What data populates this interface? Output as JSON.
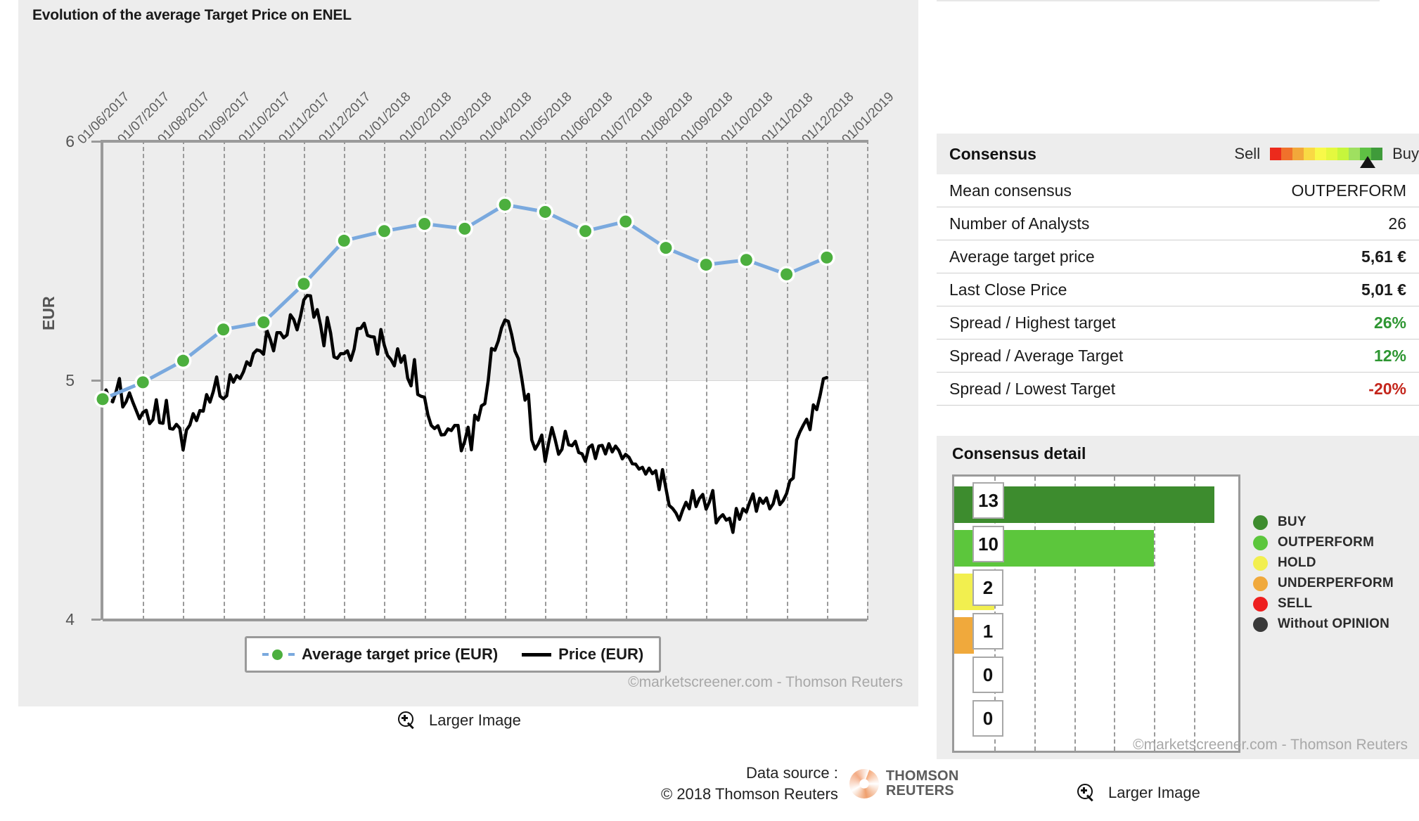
{
  "chart_panel": {
    "title": "Evolution of the average Target Price on ENEL",
    "ylabel": "EUR",
    "credit": "©marketscreener.com - Thomson Reuters",
    "legend": {
      "target_label": "Average target price (EUR)",
      "price_label": "Price (EUR)"
    },
    "larger_image_label": "Larger Image"
  },
  "datasource": {
    "line1": "Data source :",
    "line2": "© 2018 Thomson Reuters",
    "logo_line1": "THOMSON",
    "logo_line2": "REUTERS"
  },
  "consensus": {
    "title": "Consensus",
    "gauge_left": "Sell",
    "gauge_right": "Buy",
    "gauge_marker_percent": 87,
    "rows": [
      {
        "key": "Mean consensus",
        "value": "OUTPERFORM",
        "style": "plain"
      },
      {
        "key": "Number of Analysts",
        "value": "26",
        "style": "plain"
      },
      {
        "key": "Average target price",
        "value": "5,61 €",
        "style": "bold"
      },
      {
        "key": "Last Close Price",
        "value": "5,01 €",
        "style": "bold"
      },
      {
        "key": "Spread / Highest target",
        "value": "26%",
        "style": "pos"
      },
      {
        "key": "Spread / Average Target",
        "value": "12%",
        "style": "pos"
      },
      {
        "key": "Spread / Lowest Target",
        "value": "-20%",
        "style": "neg"
      }
    ]
  },
  "consensus_detail": {
    "title": "Consensus detail",
    "credit": "©marketscreener.com - Thomson Reuters",
    "larger_image_label": "Larger Image",
    "legend": [
      {
        "label": "BUY",
        "color": "#3d8c2e"
      },
      {
        "label": "OUTPERFORM",
        "color": "#5cc63c"
      },
      {
        "label": "HOLD",
        "color": "#f2ef4f"
      },
      {
        "label": "UNDERPERFORM",
        "color": "#f0a93c"
      },
      {
        "label": "SELL",
        "color": "#ee1f1f"
      },
      {
        "label": "Without OPINION",
        "color": "#3a3a3a"
      }
    ]
  },
  "chart_data": [
    {
      "type": "line",
      "title": "Evolution of the average Target Price on ENEL",
      "xlabel": "",
      "ylabel": "EUR",
      "ylim": [
        4,
        6
      ],
      "yticks": [
        4,
        5,
        6
      ],
      "grid": true,
      "legend_position": "bottom",
      "xticks": [
        "01/06/2017",
        "01/07/2017",
        "01/08/2017",
        "01/09/2017",
        "01/10/2017",
        "01/11/2017",
        "01/12/2017",
        "01/01/2018",
        "01/02/2018",
        "01/03/2018",
        "01/04/2018",
        "01/05/2018",
        "01/06/2018",
        "01/07/2018",
        "01/08/2018",
        "01/09/2018",
        "01/10/2018",
        "01/11/2018",
        "01/12/2018",
        "01/01/2019"
      ],
      "series": [
        {
          "name": "Average target price (EUR)",
          "color": "#7aa9de",
          "marker_color": "#4caf3e",
          "x": [
            "01/06/2017",
            "01/07/2017",
            "01/08/2017",
            "01/09/2017",
            "01/10/2017",
            "01/11/2017",
            "01/12/2017",
            "01/01/2018",
            "01/02/2018",
            "01/03/2018",
            "01/04/2018",
            "01/05/2018",
            "01/06/2018",
            "01/07/2018",
            "01/08/2018",
            "01/09/2018",
            "01/10/2018",
            "01/11/2018",
            "01/12/2018"
          ],
          "values": [
            4.92,
            4.99,
            5.08,
            5.21,
            5.24,
            5.4,
            5.58,
            5.62,
            5.65,
            5.63,
            5.73,
            5.7,
            5.62,
            5.66,
            5.55,
            5.48,
            5.5,
            5.44,
            5.51
          ]
        },
        {
          "name": "Price (EUR)",
          "color": "#000000",
          "x": [
            "01/06/2017",
            "01/07/2017",
            "01/08/2017",
            "01/09/2017",
            "01/10/2017",
            "01/11/2017",
            "01/12/2017",
            "01/01/2018",
            "01/02/2018",
            "01/03/2018",
            "01/04/2018",
            "01/05/2018",
            "01/06/2018",
            "01/07/2018",
            "01/08/2018",
            "01/09/2018",
            "01/10/2018",
            "01/11/2018",
            "01/12/2018",
            "01/01/2019"
          ],
          "values": [
            4.95,
            4.88,
            4.78,
            4.97,
            5.12,
            5.32,
            5.12,
            5.18,
            4.9,
            4.72,
            5.25,
            4.7,
            4.72,
            4.68,
            4.52,
            4.48,
            4.42,
            4.55,
            5.01
          ]
        }
      ]
    },
    {
      "type": "bar",
      "orientation": "horizontal",
      "title": "Consensus detail",
      "categories": [
        "BUY",
        "OUTPERFORM",
        "HOLD",
        "UNDERPERFORM",
        "SELL",
        "Without OPINION"
      ],
      "values": [
        13,
        10,
        2,
        1,
        0,
        0
      ],
      "colors": [
        "#3d8c2e",
        "#5cc63c",
        "#f2ef4f",
        "#f0a93c",
        "#ee1f1f",
        "#3a3a3a"
      ],
      "xlim": [
        0,
        14
      ],
      "grid": true
    }
  ]
}
